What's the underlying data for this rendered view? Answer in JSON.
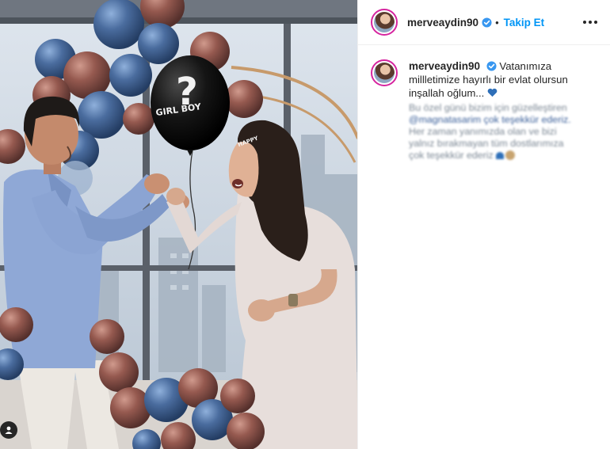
{
  "post": {
    "username": "merveaydin90",
    "follow_label": "Takip Et",
    "caption_text": "Vatanımıza millletimize hayırlı bir evlat olursun inşallah oğlum...",
    "blurred_lines": [
      "Bu özel günü bizim için güzelleştiren",
      "@magnatasarim çok teşekkür ederiz.",
      "Her zaman yanımızda olan ve bizi",
      "yalnız bırakmayan tüm dostlarımıza",
      "çok teşekkür ederiz"
    ]
  },
  "media": {
    "balloon_text": "GIRL BOY",
    "balloon_mark": "?",
    "headband_text": "HAPPY"
  },
  "colors": {
    "follow": "#0095f6",
    "verified": "#3897f0",
    "heart": "#2e6fb8",
    "balloon_blue": "#3f5f8e",
    "balloon_bronze": "#8a4f47"
  },
  "icons": {
    "verified": "verified-badge-icon",
    "more": "more-options-icon",
    "tag": "user-tag-icon",
    "heart": "blue-heart-icon"
  }
}
